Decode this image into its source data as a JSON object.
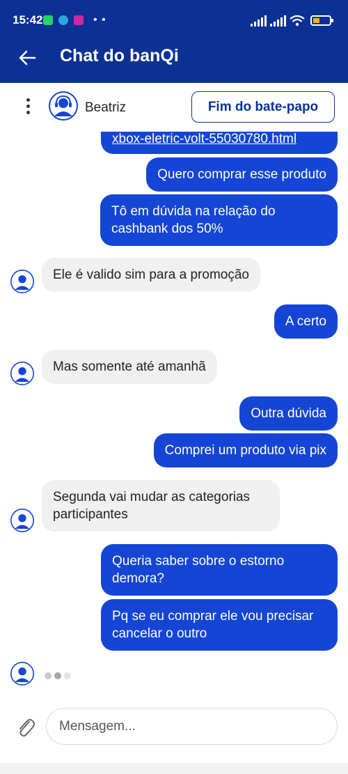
{
  "status_bar": {
    "time": "15:42"
  },
  "app_bar": {
    "title": "Chat do banQi"
  },
  "agent": {
    "name": "Beatriz",
    "end_button": "Fim do bate-papo"
  },
  "messages": [
    {
      "side": "sent",
      "text": "xbox-eletric-volt-55030780.html"
    },
    {
      "side": "sent",
      "text": "Quero comprar esse produto"
    },
    {
      "side": "sent",
      "text": "Tô em dúvida na relação do cashbank dos 50%"
    },
    {
      "side": "received",
      "text": "Ele é valido sim para a promoção"
    },
    {
      "side": "sent",
      "text": "A certo"
    },
    {
      "side": "received",
      "text": "Mas somente até amanhã"
    },
    {
      "side": "sent",
      "text": "Outra dúvida"
    },
    {
      "side": "sent",
      "text": "Comprei um produto via pix"
    },
    {
      "side": "received",
      "text": "Segunda vai mudar as categorias participantes"
    },
    {
      "side": "sent",
      "text": "Queria saber sobre o estorno demora?"
    },
    {
      "side": "sent",
      "text": "Pq se eu comprar ele vou precisar cancelar o outro"
    }
  ],
  "composer": {
    "placeholder": "Mensagem..."
  },
  "colors": {
    "brand": "#0c3194",
    "sent_bubble": "#1545d4",
    "received_bubble": "#f0f0f0"
  }
}
